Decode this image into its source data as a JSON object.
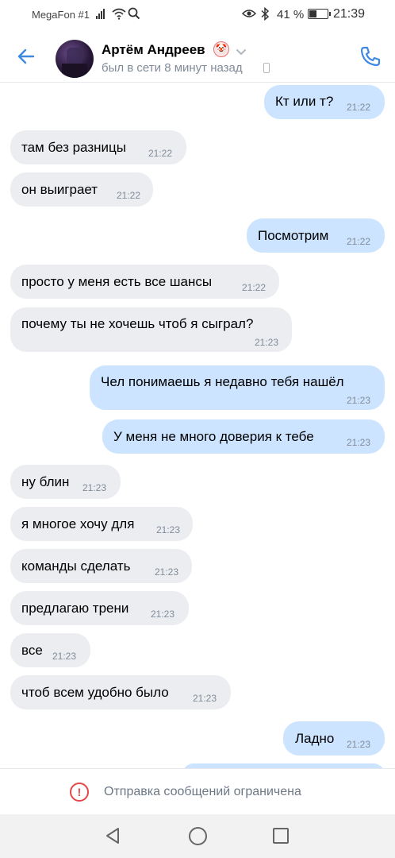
{
  "status_bar": {
    "carrier": "MegaFon #1",
    "battery_pct": "41 %",
    "battery_level": 0.41,
    "time": "21:39"
  },
  "header": {
    "contact_name": "Артём Андреев",
    "contact_status": "был в сети 8 минут назад"
  },
  "messages": [
    {
      "dir": "out",
      "text": "Кт или т?",
      "time": "21:22"
    },
    {
      "dir": "in",
      "text": "там без разницы",
      "time": "21:22"
    },
    {
      "dir": "in",
      "text": "он выиграет",
      "time": "21:22"
    },
    {
      "dir": "out",
      "text": "Посмотрим",
      "time": "21:22"
    },
    {
      "dir": "in",
      "text": "просто у меня есть все шансы",
      "time": "21:22"
    },
    {
      "dir": "in",
      "text": "почему ты не хочешь чтоб я сыграл?",
      "time": "21:23"
    },
    {
      "dir": "out",
      "text": "Чел понимаешь я недавно тебя нашёл",
      "time": "21:23"
    },
    {
      "dir": "out",
      "text": "У меня не много доверия к тебе",
      "time": "21:23"
    },
    {
      "dir": "in",
      "text": "ну блин",
      "time": "21:23"
    },
    {
      "dir": "in",
      "text": "я многое хочу для",
      "time": "21:23"
    },
    {
      "dir": "in",
      "text": "команды сделать",
      "time": "21:23"
    },
    {
      "dir": "in",
      "text": "предлагаю трени",
      "time": "21:23"
    },
    {
      "dir": "in",
      "text": "все",
      "time": "21:23"
    },
    {
      "dir": "in",
      "text": "чтоб всем удобно было",
      "time": "21:23"
    },
    {
      "dir": "out",
      "text": "Ладно",
      "time": "21:23"
    }
  ],
  "restriction": {
    "text": "Отправка сообщений ограничена"
  },
  "icons": {
    "back": "arrow-left-icon",
    "call": "phone-call-icon",
    "warning": "exclamation-circle-icon"
  },
  "colors": {
    "accent": "#3f8ae0",
    "incoming_bubble": "#ebedf0",
    "outgoing_bubble": "#cce4ff",
    "warning": "#e64646"
  }
}
